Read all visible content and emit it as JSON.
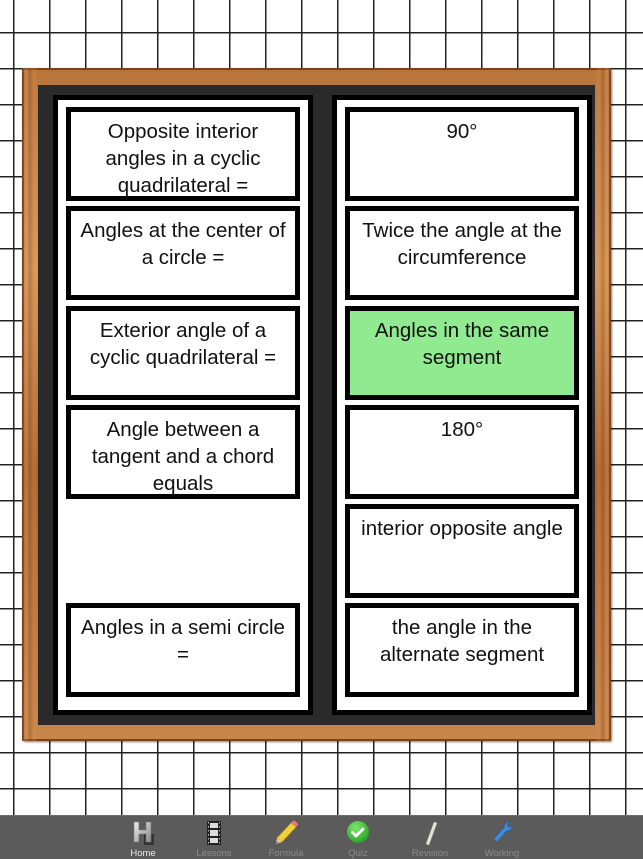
{
  "left_cards": [
    {
      "text": "Opposite interior angles in a cyclic quadrilateral =",
      "selected": false,
      "row": 0
    },
    {
      "text": "Angles at the center of a circle =",
      "selected": false,
      "row": 1
    },
    {
      "text": "Exterior angle of a cyclic quadrilateral =",
      "selected": false,
      "row": 2
    },
    {
      "text": "Angle between a tangent and a chord equals",
      "selected": false,
      "row": 3
    },
    {
      "text": "Angles in a semi circle =",
      "selected": false,
      "row": 5
    }
  ],
  "right_cards": [
    {
      "text": "90°",
      "selected": false,
      "row": 0
    },
    {
      "text": "Twice the angle at the circumference",
      "selected": false,
      "row": 1
    },
    {
      "text": "Angles in the same segment",
      "selected": true,
      "row": 2
    },
    {
      "text": "180°",
      "selected": false,
      "row": 3
    },
    {
      "text": "interior opposite angle",
      "selected": false,
      "row": 4
    },
    {
      "text": "the angle in the alternate segment",
      "selected": false,
      "row": 5
    }
  ],
  "colors": {
    "selected_card": "#90ea90",
    "tabbar_bg": "#5b5b5b",
    "board": "#2a2a2a"
  },
  "tabbar": {
    "tabs": [
      {
        "label": "Home",
        "icon": "home-h-icon",
        "active": true
      },
      {
        "label": "Lessons",
        "icon": "film-strip-icon",
        "active": false
      },
      {
        "label": "Formula",
        "icon": "pencil-icon",
        "active": false
      },
      {
        "label": "Quiz",
        "icon": "checkmark-circle-icon",
        "active": false
      },
      {
        "label": "Revision",
        "icon": "chalk-icon",
        "active": false
      },
      {
        "label": "Working",
        "icon": "wrench-icon",
        "active": false
      }
    ]
  }
}
